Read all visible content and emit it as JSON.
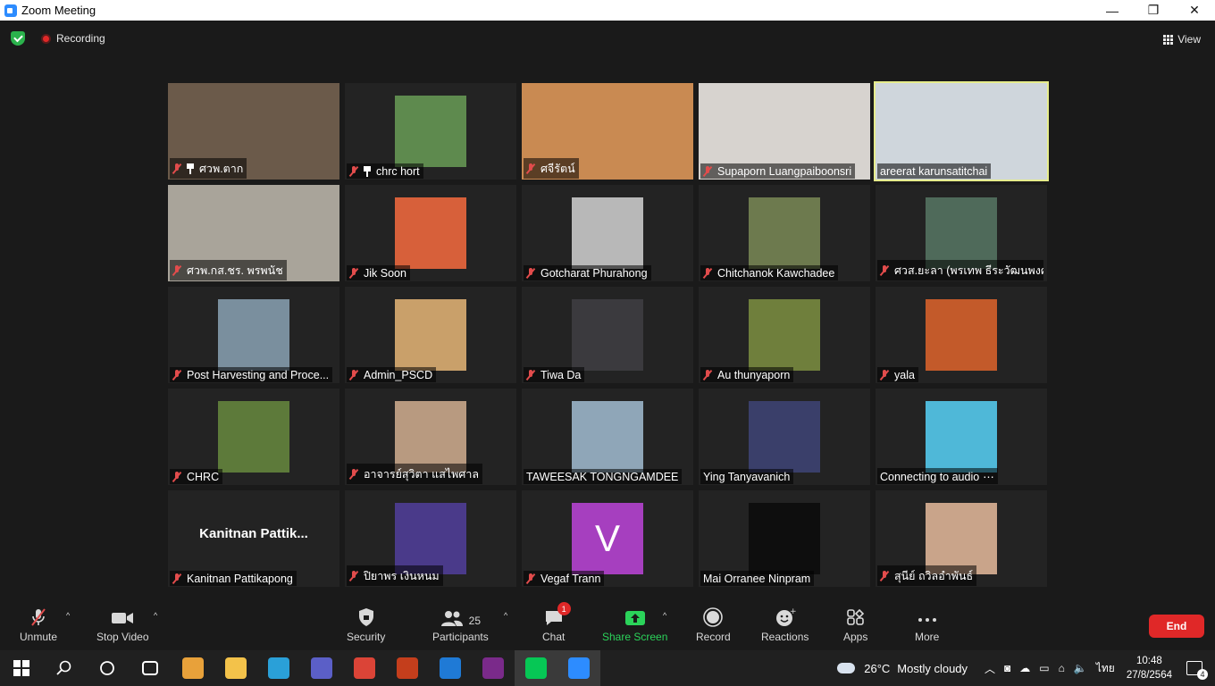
{
  "window": {
    "title": "Zoom Meeting",
    "minimize": "—",
    "maximize": "❐",
    "close": "✕"
  },
  "meeting": {
    "recording_label": "Recording",
    "view_label": "View"
  },
  "participants": [
    {
      "name": "ศวพ.ตาก",
      "muted": true,
      "pinned": true,
      "bg": "#6b5a4a",
      "video": true
    },
    {
      "name": "chrc hort",
      "muted": true,
      "pinned": true,
      "bg": "#5e8a4e",
      "avatar": true
    },
    {
      "name": "ศจีรัตน์",
      "muted": true,
      "bg": "#c98a52",
      "video": true
    },
    {
      "name": "Supaporn Luangpaiboonsri",
      "muted": true,
      "bg": "#d7d3cf",
      "video": true
    },
    {
      "name": "areerat karunsatitchai",
      "muted": false,
      "bg": "#cfd6dc",
      "video": true,
      "active": true
    },
    {
      "name": "ศวพ.กส.ชร. พรพนัช",
      "muted": true,
      "bg": "#a9a49a",
      "video": true
    },
    {
      "name": "Jik Soon",
      "muted": true,
      "bg": "#d7603a",
      "avatar": true
    },
    {
      "name": "Gotcharat Phurahong",
      "muted": true,
      "bg": "#b8b8b8",
      "avatar": true
    },
    {
      "name": "Chitchanok Kawchadee",
      "muted": true,
      "bg": "#6d7a4e",
      "avatar": true
    },
    {
      "name": "ศวส.ยะลา (พรเทพ ธีระวัฒนพงศ์)",
      "muted": true,
      "bg": "#4f6a5a",
      "avatar": true
    },
    {
      "name": "Post Harvesting and Proce...",
      "muted": true,
      "bg": "#7a8f9e",
      "avatar": true
    },
    {
      "name": "Admin_PSCD",
      "muted": true,
      "bg": "#c9a06a",
      "avatar": true
    },
    {
      "name": "Tiwa Da",
      "muted": true,
      "bg": "#3b3a3e",
      "avatar": true
    },
    {
      "name": "Au thunyaporn",
      "muted": true,
      "bg": "#6f7f3c",
      "avatar": true
    },
    {
      "name": "yala",
      "muted": true,
      "bg": "#c35a2a",
      "avatar": true
    },
    {
      "name": "CHRC",
      "muted": true,
      "bg": "#5d7a3a",
      "avatar": true
    },
    {
      "name": "อาจารย์สุวิตา แสไพศาล",
      "muted": true,
      "bg": "#b89a80",
      "avatar": true
    },
    {
      "name": "TAWEESAK TONGNGAMDEE",
      "muted": false,
      "bg": "#8fa6b8",
      "avatar": true
    },
    {
      "name": "Ying Tanyavanich",
      "muted": false,
      "bg": "#3a3f6a",
      "avatar": true
    },
    {
      "name": "Connecting to audio",
      "muted": false,
      "bg": "#4fb8d8",
      "avatar": true,
      "dots": "⋯"
    },
    {
      "name": "Kanitnan Pattikapong",
      "muted": true,
      "big_name": "Kanitnan Pattik..."
    },
    {
      "name": "ปิยาพร เงินหนม",
      "muted": true,
      "bg": "#4a3a8a",
      "avatar": true
    },
    {
      "name": "Vegaf Trann",
      "muted": true,
      "letter": "V"
    },
    {
      "name": "Mai Orranee Ninpram",
      "muted": false,
      "bg": "#0e0e0e",
      "avatar": true
    },
    {
      "name": "สุนีย์ ถวิลอำพันธ์",
      "muted": true,
      "bg": "#c9a48a",
      "avatar": true
    }
  ],
  "toolbar": {
    "unmute": "Unmute",
    "stop_video": "Stop Video",
    "security": "Security",
    "participants": "Participants",
    "participants_count": "25",
    "chat": "Chat",
    "chat_badge": "1",
    "share_screen": "Share Screen",
    "record": "Record",
    "reactions": "Reactions",
    "apps": "Apps",
    "more": "More",
    "end": "End",
    "caret": "^"
  },
  "taskbar": {
    "temperature": "26°C",
    "weather": "Mostly cloudy",
    "language": "ไทย",
    "time": "10:48",
    "date": "27/8/2564",
    "notifications": "4",
    "apps": [
      {
        "name": "task-view",
        "color": "#ffffff"
      },
      {
        "name": "store",
        "color": "#e8a13a"
      },
      {
        "name": "file-explorer",
        "color": "#f3c24a"
      },
      {
        "name": "edge",
        "color": "#2aa0d8"
      },
      {
        "name": "teams",
        "color": "#5b5fc7"
      },
      {
        "name": "chrome",
        "color": "#db4437"
      },
      {
        "name": "powerpoint",
        "color": "#c43e1c"
      },
      {
        "name": "media-player",
        "color": "#1f7ad6"
      },
      {
        "name": "pdf-app",
        "color": "#7a2a8a"
      },
      {
        "name": "line",
        "color": "#06c755"
      },
      {
        "name": "zoom",
        "color": "#2d8cff"
      }
    ]
  }
}
